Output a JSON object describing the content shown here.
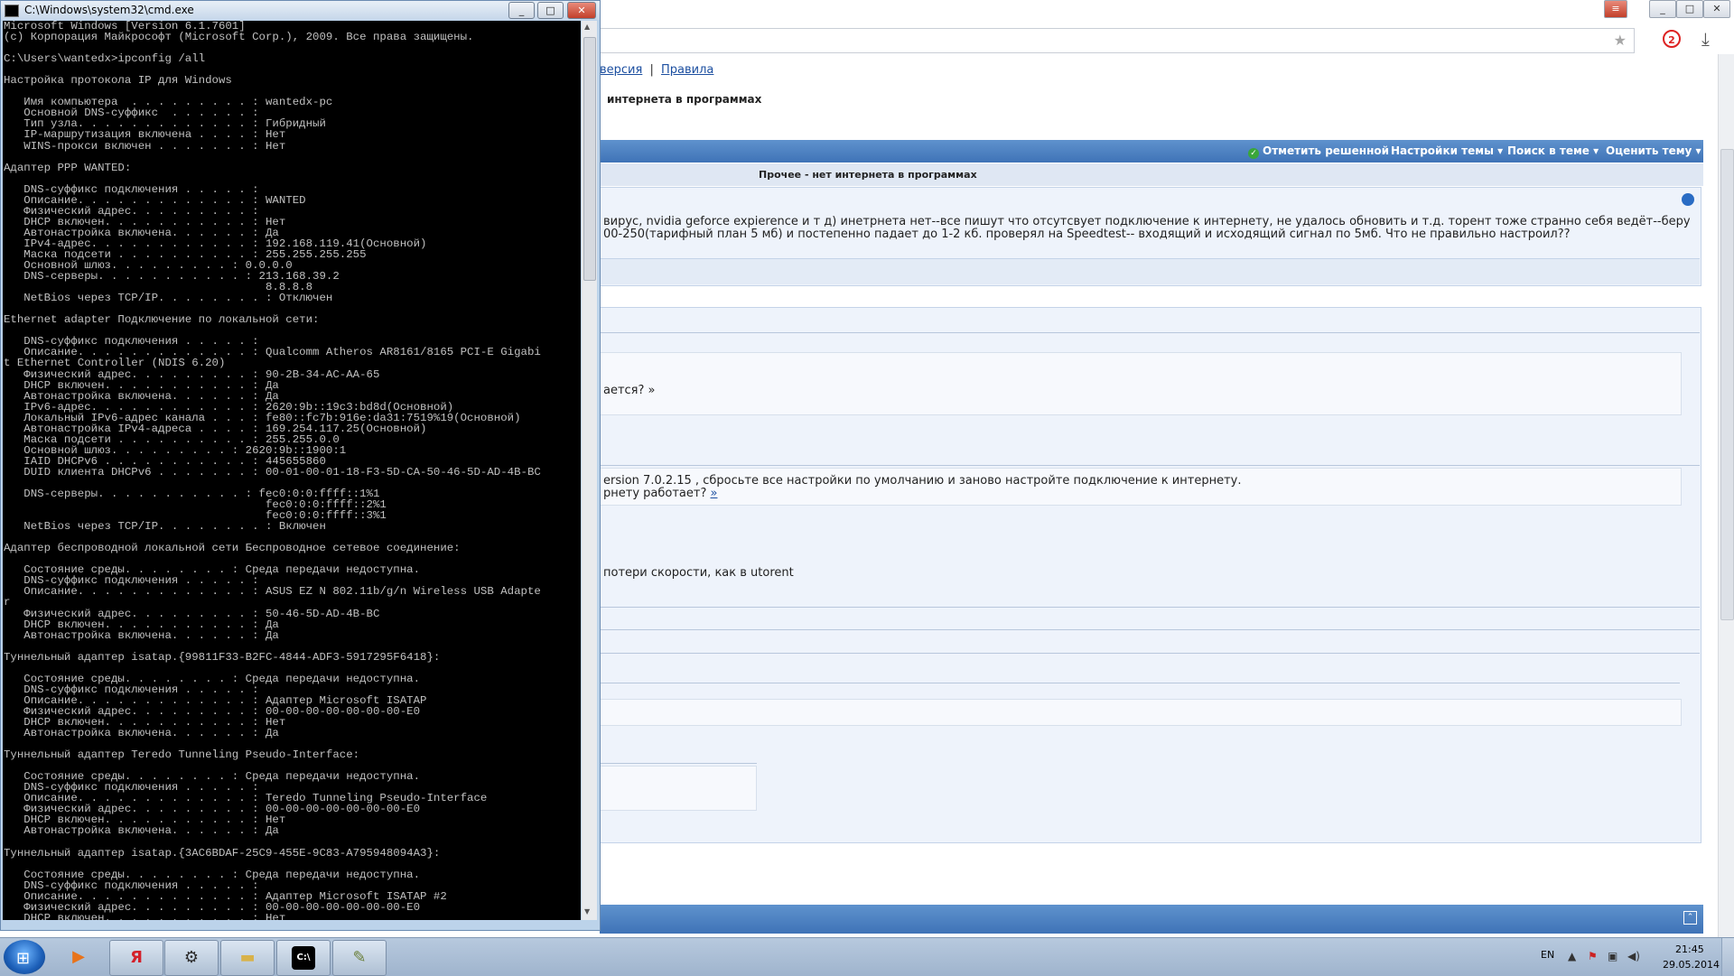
{
  "browser": {
    "crumb_link_1": "версия",
    "crumb_sep": "|",
    "crumb_link_2": "Правила",
    "thread_title": "интернета в программах",
    "toolbar": {
      "mark_solved": "Отметить решенной",
      "thread_settings": "Настройки темы ▾",
      "search_thread": "Поиск в теме ▾",
      "rate_thread": "Оценить тему ▾"
    },
    "post_title": "Прочее - нет интернета в программах",
    "post_text_1": "вирус, nvidia geforce expierence и т д) инетрнета нет--все пишут что отсутсвует подключение к интернету, не удалось обновить и т.д. торент тоже странно себя ведёт--беру",
    "post_text_2": "00-250(тарифный план 5 мб) и постепенно падает до 1-2 кб. проверял на Speedtest-- входящий и исходящий сигнал по 5мб. Что не правильно настроил??",
    "reply_1": "ается? »",
    "reply_2_line_1": "ersion 7.0.2.15 , сбросьте все настройки по умолчанию и заново настройте подключение к интернету.",
    "reply_2_line_2": "рнету работает?",
    "reply_2_link": "»",
    "reply_3": "потери скорости, как в utorent"
  },
  "cmd": {
    "title": "C:\\Windows\\system32\\cmd.exe",
    "min_label": "_",
    "max_label": "□",
    "close_label": "✕",
    "output": "Microsoft Windows [Version 6.1.7601]\n(c) Корпорация Майкрософт (Microsoft Corp.), 2009. Все права защищены.\n\nC:\\Users\\wantedx>ipconfig /all\n\nНастройка протокола IP для Windows\n\n   Имя компьютера  . . . . . . . . . : wantedx-pc\n   Основной DNS-суффикс  . . . . . . :\n   Тип узла. . . . . . . . . . . . . : Гибридный\n   IP-маршрутизация включена . . . . : Нет\n   WINS-прокси включен . . . . . . . : Нет\n\nАдаптер PPP WANTED:\n\n   DNS-суффикс подключения . . . . . :\n   Описание. . . . . . . . . . . . . : WANTED\n   Физический адрес. . . . . . . . . :\n   DHCP включен. . . . . . . . . . . : Нет\n   Автонастройка включена. . . . . . : Да\n   IPv4-адрес. . . . . . . . . . . . : 192.168.119.41(Основной)\n   Маска подсети . . . . . . . . . . : 255.255.255.255\n   Основной шлюз. . . . . . . . . : 0.0.0.0\n   DNS-серверы. . . . . . . . . . . : 213.168.39.2\n                                       8.8.8.8\n   NetBios через TCP/IP. . . . . . . . : Отключен\n\nEthernet adapter Подключение по локальной сети:\n\n   DNS-суффикс подключения . . . . . :\n   Описание. . . . . . . . . . . . . : Qualcomm Atheros AR8161/8165 PCI-E Gigabi\nt Ethernet Controller (NDIS 6.20)\n   Физический адрес. . . . . . . . . : 90-2B-34-AC-AA-65\n   DHCP включен. . . . . . . . . . . : Да\n   Автонастройка включена. . . . . . : Да\n   IPv6-адрес. . . . . . . . . . . . : 2620:9b::19c3:bd8d(Основной)\n   Локальный IPv6-адрес канала . . . : fe80::fc7b:916e:da31:7519%19(Основной)\n   Автонастройка IPv4-адреса . . . . : 169.254.117.25(Основной)\n   Маска подсети . . . . . . . . . . : 255.255.0.0\n   Основной шлюз. . . . . . . . . : 2620:9b::1900:1\n   IAID DHCPv6 . . . . . . . . . . . : 445655860\n   DUID клиента DHCPv6 . . . . . . . : 00-01-00-01-18-F3-5D-CA-50-46-5D-AD-4B-BC\n\n   DNS-серверы. . . . . . . . . . . : fec0:0:0:ffff::1%1\n                                       fec0:0:0:ffff::2%1\n                                       fec0:0:0:ffff::3%1\n   NetBios через TCP/IP. . . . . . . . : Включен\n\nАдаптер беспроводной локальной сети Беспроводное сетевое соединение:\n\n   Состояние среды. . . . . . . . : Среда передачи недоступна.\n   DNS-суффикс подключения . . . . . :\n   Описание. . . . . . . . . . . . . : ASUS EZ N 802.11b/g/n Wireless USB Adapte\nr\n   Физический адрес. . . . . . . . . : 50-46-5D-AD-4B-BC\n   DHCP включен. . . . . . . . . . . : Да\n   Автонастройка включена. . . . . . : Да\n\nТуннельный адаптер isatap.{99811F33-B2FC-4844-ADF3-5917295F6418}:\n\n   Состояние среды. . . . . . . . : Среда передачи недоступна.\n   DNS-суффикс подключения . . . . . :\n   Описание. . . . . . . . . . . . . : Адаптер Microsoft ISATAP\n   Физический адрес. . . . . . . . . : 00-00-00-00-00-00-00-E0\n   DHCP включен. . . . . . . . . . . : Нет\n   Автонастройка включена. . . . . . : Да\n\nТуннельный адаптер Teredo Tunneling Pseudo-Interface:\n\n   Состояние среды. . . . . . . . : Среда передачи недоступна.\n   DNS-суффикс подключения . . . . . :\n   Описание. . . . . . . . . . . . . : Teredo Tunneling Pseudo-Interface\n   Физический адрес. . . . . . . . . : 00-00-00-00-00-00-00-E0\n   DHCP включен. . . . . . . . . . . : Нет\n   Автонастройка включена. . . . . . : Да\n\nТуннельный адаптер isatap.{3AC6BDAF-25C9-455E-9C83-A795948094A3}:\n\n   Состояние среды. . . . . . . . : Среда передачи недоступна.\n   DNS-суффикс подключения . . . . . :\n   Описание. . . . . . . . . . . . . : Адаптер Microsoft ISATAP #2\n   Физический адрес. . . . . . . . . : 00-00-00-00-00-00-00-E0\n   DHCP включен. . . . . . . . . . . : Нет"
  },
  "taskbar": {
    "lang": "EN",
    "time": "21:45",
    "date": "29.05.2014",
    "items": [
      {
        "name": "media-player-icon",
        "glyph": "▶",
        "color": "#e8731a"
      },
      {
        "name": "yandex-browser-icon",
        "glyph": "Я",
        "color": "#d4202a"
      },
      {
        "name": "steam-icon",
        "glyph": "⚙",
        "color": "#2b2b2b"
      },
      {
        "name": "explorer-folder-icon",
        "glyph": "▬",
        "color": "#d8b24a"
      },
      {
        "name": "cmd-icon",
        "glyph": "C:\\",
        "color": "#000000"
      },
      {
        "name": "paint-icon",
        "glyph": "✎",
        "color": "#6a7f3a"
      }
    ]
  }
}
